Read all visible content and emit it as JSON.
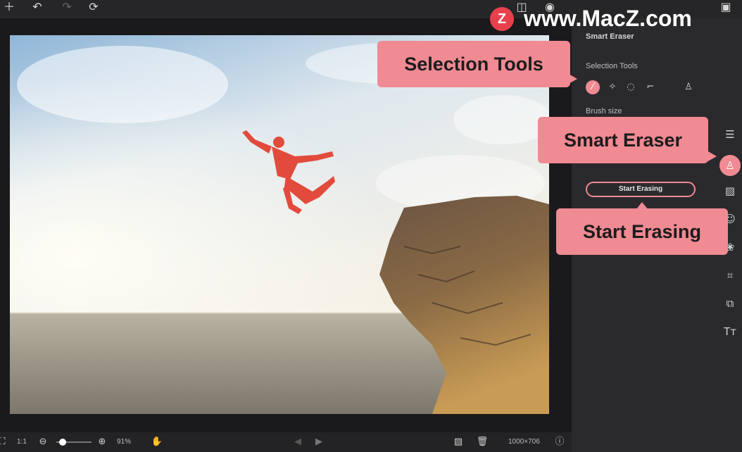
{
  "watermark": {
    "text": "www.MacZ.com",
    "logo_letter": "Z"
  },
  "panel": {
    "title": "Smart Eraser",
    "selection_tools_label": "Selection Tools",
    "brush_size_label": "Brush size",
    "start_erasing_label": "Start Erasing"
  },
  "callouts": {
    "selection_tools": "Selection Tools",
    "smart_eraser": "Smart Eraser",
    "start_erasing": "Start Erasing"
  },
  "bottombar": {
    "ratio": "1:1",
    "zoom": "91%",
    "dimensions": "1000×706"
  },
  "zoom_level": 0.1,
  "colors": {
    "accent": "#f08a93",
    "panel_bg": "#2a2a2d",
    "canvas_bg": "#1a1a1c"
  },
  "icons": {
    "top_left": [
      "plus-icon",
      "undo-icon",
      "redo-icon",
      "reset-icon"
    ],
    "top_right": [
      "compare-icon",
      "preview-icon",
      "save-icon"
    ],
    "rail": [
      "adjust-icon",
      "eraser-icon",
      "image-icon",
      "face-icon",
      "color-icon",
      "crop-icon",
      "resize-icon",
      "text-icon"
    ]
  }
}
